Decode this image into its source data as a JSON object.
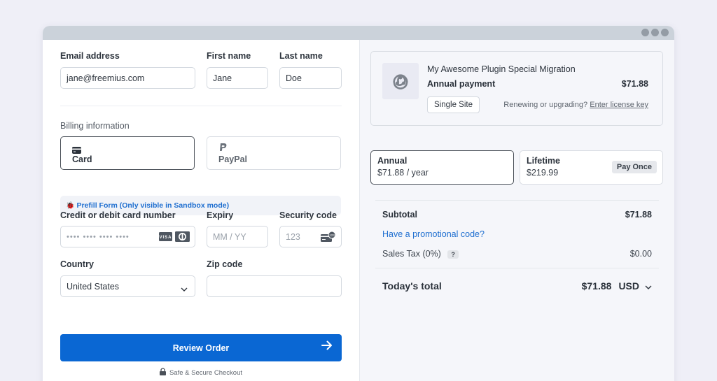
{
  "window": {
    "dots": [
      "dot-1",
      "dot-2",
      "dot-3"
    ]
  },
  "form": {
    "email": {
      "label": "Email address",
      "value": "jane@freemius.com"
    },
    "first_name": {
      "label": "First name",
      "value": "Jane"
    },
    "last_name": {
      "label": "Last name",
      "value": "Doe"
    },
    "billing_label": "Billing information",
    "payment_methods": [
      {
        "label": "Card",
        "icon": "credit-card-icon",
        "selected": true
      },
      {
        "label": "PayPal",
        "icon": "paypal-icon",
        "selected": false
      }
    ],
    "prefill": {
      "icon": "bug-icon",
      "label": "Prefill Form (Only visible in Sandbox mode)"
    },
    "card_number": {
      "label": "Credit or debit card number",
      "placeholder": "•••• •••• •••• ••••",
      "brands": [
        "VISA",
        "Diners Club"
      ]
    },
    "expiry": {
      "label": "Expiry",
      "placeholder": "MM / YY"
    },
    "security_code": {
      "label": "Security code",
      "placeholder": "123"
    },
    "country": {
      "label": "Country",
      "value": "United States"
    },
    "zip": {
      "label": "Zip code",
      "value": ""
    },
    "review_button": "Review Order",
    "secure_label": "Safe & Secure Checkout"
  },
  "summary": {
    "product_name": "My Awesome Plugin Special Migration",
    "plan": "Annual payment",
    "price": "$71.88",
    "license_button": "Single Site",
    "renew_text": "Renewing or upgrading?",
    "renew_link": "Enter license key",
    "cycles": [
      {
        "name": "Annual",
        "price": "$71.88 / year",
        "selected": true
      },
      {
        "name": "Lifetime",
        "price": "$219.99",
        "badge": "Pay Once",
        "selected": false
      }
    ],
    "subtotal_label": "Subtotal",
    "subtotal_value": "$71.88",
    "promo_link": "Have a promotional code?",
    "tax_label": "Sales Tax (0%)",
    "tax_help": "?",
    "tax_value": "$0.00",
    "total_label": "Today's total",
    "total_value": "$71.88",
    "currency": "USD"
  },
  "colors": {
    "accent": "#0a67d3",
    "link": "#1f6fd0",
    "background": "#efeff7",
    "titlebar": "#cbd2da"
  }
}
